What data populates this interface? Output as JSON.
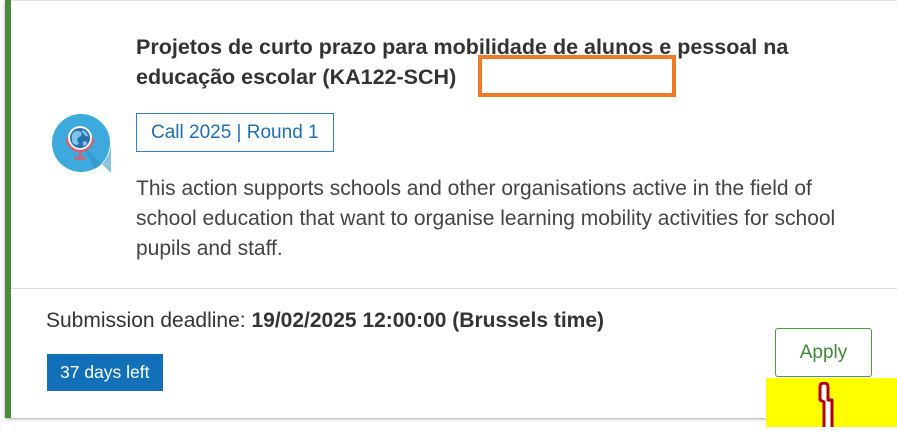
{
  "card": {
    "title": "Projetos de curto prazo para mobilidade de alunos e pessoal na educação escolar (KA122-SCH)",
    "call_badge": "Call 2025 | Round 1",
    "description": "This action supports schools and other organisations active in the field of school education that want to organise learning mobility activities for school pupils and staff.",
    "deadline_label": "Submission deadline:",
    "deadline_value": "19/02/2025 12:00:00 (Brussels time)",
    "days_left": "37 days left",
    "apply_label": "Apply"
  },
  "colors": {
    "accent_border": "#4a8a3c",
    "link_blue": "#1f6fb3",
    "badge_blue": "#1170b8",
    "apply_green": "#3e8a34",
    "highlight_orange": "#f07a28",
    "highlight_yellow": "#ffff00"
  },
  "icons": {
    "topic_icon": "globe-icon",
    "cursor": "hand-pointer-icon"
  }
}
